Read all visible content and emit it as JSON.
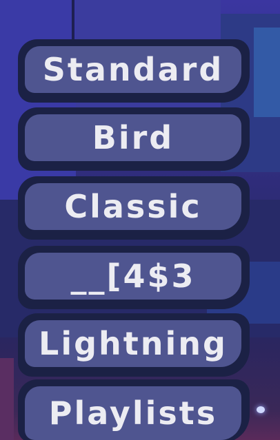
{
  "menu": {
    "items": [
      {
        "label": "Standard"
      },
      {
        "label": "Bird"
      },
      {
        "label": "Classic"
      },
      {
        "label": "__[4$3"
      },
      {
        "label": "Lightning"
      },
      {
        "label": "Playlists"
      }
    ]
  },
  "colors": {
    "button_face": "#4f5590",
    "button_border": "#1b2145",
    "button_text": "#ececf2",
    "background": "#2c2a6a"
  }
}
